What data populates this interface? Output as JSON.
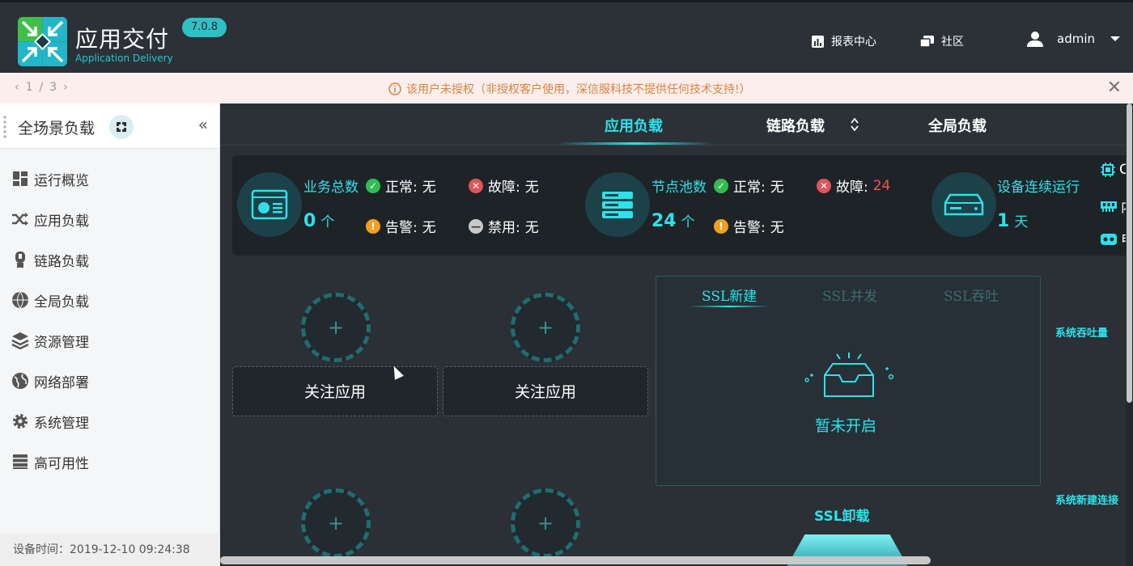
{
  "header": {
    "app_title": "应用交付",
    "app_subtitle": "Application Delivery",
    "version": "7.0.8",
    "nav": {
      "report_center": "报表中心",
      "community": "社区"
    },
    "user": "admin"
  },
  "notice": {
    "pager": {
      "current": "1",
      "sep": "/",
      "total": "3"
    },
    "message": "该用户未授权（非授权客户使用，深信服科技不提供任何技术支持!）"
  },
  "sidebar": {
    "title": "全场景负载",
    "items": [
      {
        "label": "运行概览",
        "icon": "dashboard-icon"
      },
      {
        "label": "应用负载",
        "icon": "shuffle-icon"
      },
      {
        "label": "链路负载",
        "icon": "link-load-icon"
      },
      {
        "label": "全局负载",
        "icon": "dns-globe-icon"
      },
      {
        "label": "资源管理",
        "icon": "layers-icon"
      },
      {
        "label": "网络部署",
        "icon": "globe-icon"
      },
      {
        "label": "系统管理",
        "icon": "gear-icon"
      },
      {
        "label": "高可用性",
        "icon": "server-stack-icon"
      }
    ],
    "device_time_label": "设备时间：",
    "device_time": "2019-12-10 09:24:38"
  },
  "tabs": {
    "app_load": "应用负载",
    "link_load": "链路负载",
    "global_load": "全局负载"
  },
  "stats": {
    "business": {
      "label": "业务总数",
      "value": "0",
      "unit": "个",
      "normal_label": "正常:",
      "normal_value": "无",
      "fault_label": "故障:",
      "fault_value": "无",
      "warn_label": "告警:",
      "warn_value": "无",
      "disabled_label": "禁用:",
      "disabled_value": "无"
    },
    "pool": {
      "label": "节点池数",
      "value": "24",
      "unit": "个",
      "normal_label": "正常:",
      "normal_value": "无",
      "fault_label": "故障:",
      "fault_value": "24",
      "warn_label": "告警:",
      "warn_value": "无"
    },
    "uptime": {
      "label": "设备连续运行",
      "value": "1",
      "unit": "天"
    },
    "hardware": [
      "CP",
      "内",
      "电"
    ]
  },
  "follow": {
    "label": "关注应用",
    "plus": "+"
  },
  "ssl": {
    "tabs": [
      "SSL新建",
      "SSL并发",
      "SSL吞吐"
    ],
    "empty_text": "暂未开启",
    "offload_label": "SSL卸载"
  },
  "right_labels": {
    "throughput": "系统吞吐量",
    "new_conn": "系统新建连接"
  },
  "colors": {
    "accent": "#2de2ea",
    "fault": "#ee5555",
    "normal": "#2fbf4f",
    "warning": "#f0a020"
  }
}
